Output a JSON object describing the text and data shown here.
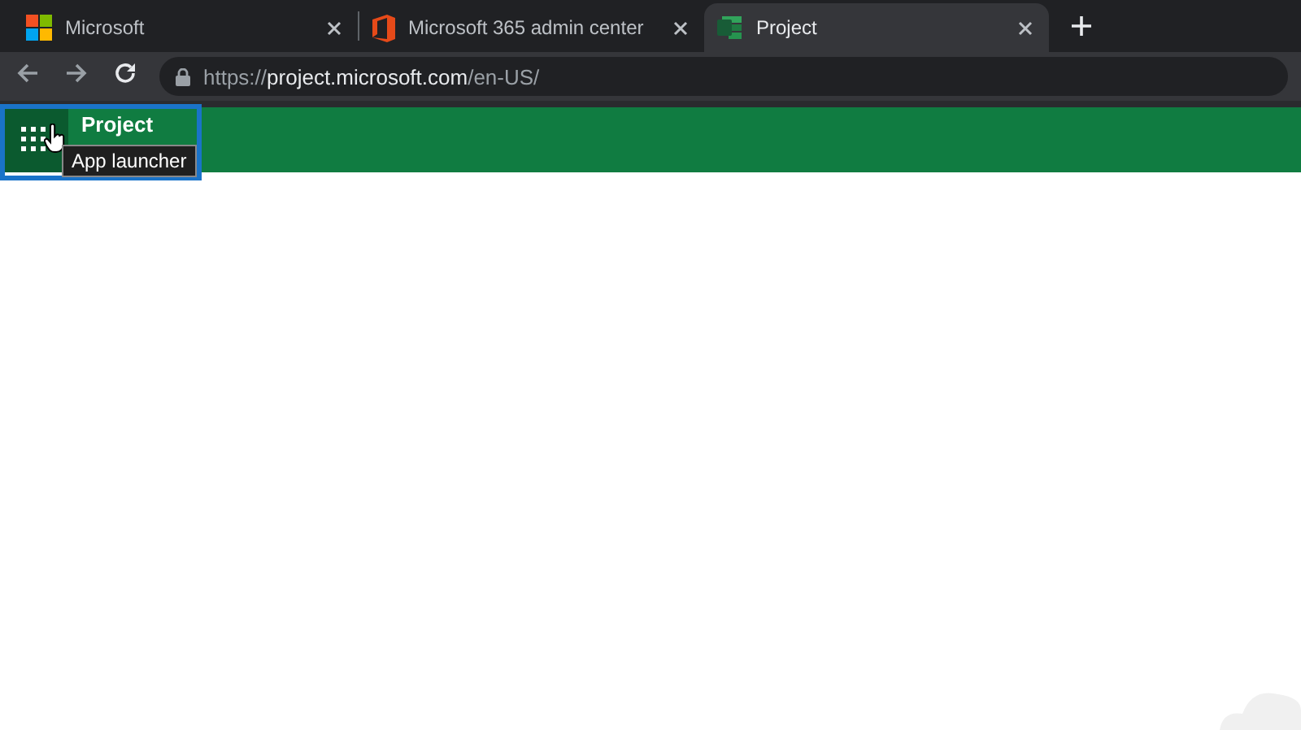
{
  "tabs": [
    {
      "title": "Microsoft",
      "selected": false
    },
    {
      "title": "Microsoft 365 admin center",
      "selected": false
    },
    {
      "title": "Project",
      "selected": true
    }
  ],
  "address_bar": {
    "scheme": "https://",
    "host": "project.microsoft.com",
    "path": "/en-US/"
  },
  "app_bar": {
    "title": "Project",
    "tooltip": "App launcher",
    "highlighted": true
  }
}
